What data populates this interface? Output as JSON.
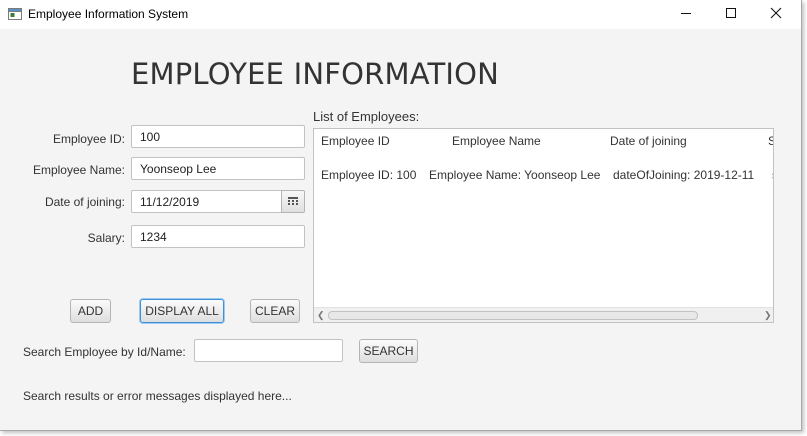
{
  "window": {
    "title": "Employee Information System"
  },
  "header": {
    "title": "EMPLOYEE INFORMATION"
  },
  "form": {
    "id_label": "Employee ID:",
    "id_value": "100",
    "name_label": "Employee Name:",
    "name_value": "Yoonseop Lee",
    "date_label": "Date of joining:",
    "date_value": "11/12/2019",
    "salary_label": "Salary:",
    "salary_value": "1234"
  },
  "buttons": {
    "add": "ADD",
    "display_all": "DISPLAY ALL",
    "clear": "CLEAR",
    "search": "SEARCH"
  },
  "list": {
    "label": "List of Employees:",
    "columns": [
      "Employee ID",
      "Employee Name",
      "Date of joining",
      "S"
    ],
    "rows": [
      [
        "Employee ID: 100",
        "Employee Name: Yoonseop Lee",
        "dateOfJoining: 2019-12-11",
        "s"
      ]
    ]
  },
  "search": {
    "label": "Search Employee by Id/Name:",
    "value": ""
  },
  "status": {
    "message": "Search results or error messages displayed here..."
  },
  "colors": {
    "background": "#f4f4f4",
    "focus_accent": "#3d8fd6"
  },
  "icons": {
    "app": "java-app-icon",
    "minimize": "minimize-icon",
    "maximize": "maximize-icon",
    "close": "close-icon",
    "calendar": "calendar-icon"
  }
}
